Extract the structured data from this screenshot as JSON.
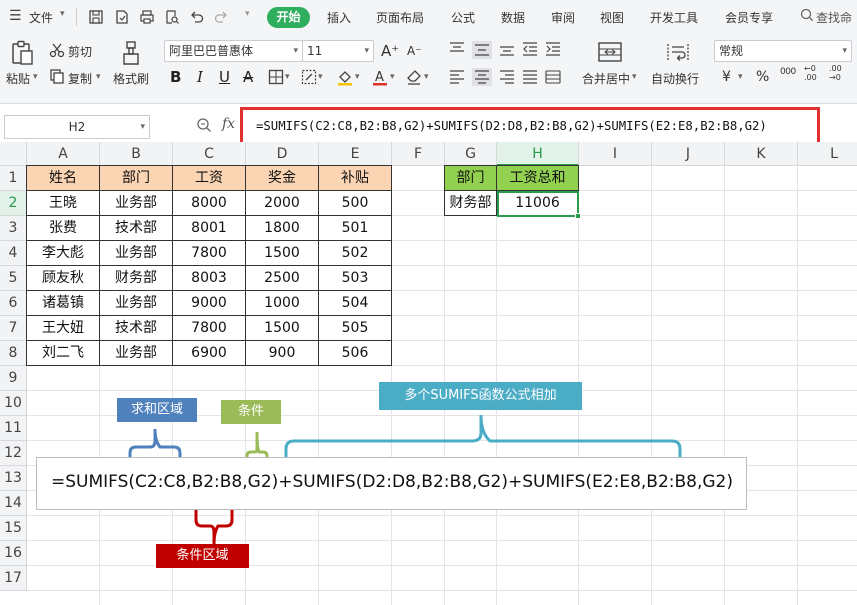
{
  "menubar": {
    "file_label": "文件",
    "tabs": [
      "开始",
      "插入",
      "页面布局",
      "公式",
      "数据",
      "审阅",
      "视图",
      "开发工具",
      "会员专享"
    ],
    "search_label": "查找命"
  },
  "ribbon": {
    "paste_label": "粘贴",
    "cut_label": "剪切",
    "copy_label": "复制",
    "format_painter_label": "格式刷",
    "font_name": "阿里巴巴普惠体",
    "font_size": "11",
    "merge_label": "合并居中",
    "wrap_label": "自动换行",
    "number_format": "常规",
    "currency_symbol": "¥",
    "percent_symbol": "%",
    "thousands_symbol": "000"
  },
  "formula_bar": {
    "name_box": "H2",
    "fx": "fx",
    "formula": "=SUMIFS(C2:C8,B2:B8,G2)+SUMIFS(D2:D8,B2:B8,G2)+SUMIFS(E2:E8,B2:B8,G2)"
  },
  "sheet": {
    "columns": [
      "A",
      "B",
      "C",
      "D",
      "E",
      "F",
      "G",
      "H",
      "I",
      "J",
      "K",
      "L"
    ],
    "rows": [
      "1",
      "2",
      "3",
      "4",
      "5",
      "6",
      "7",
      "8",
      "9",
      "10",
      "11",
      "12",
      "13",
      "14",
      "15",
      "16",
      "17"
    ],
    "selected_column": "H",
    "selected_row": "2",
    "table_headers": [
      "姓名",
      "部门",
      "工资",
      "奖金",
      "补贴"
    ],
    "table_rows": [
      [
        "王晓",
        "业务部",
        "8000",
        "2000",
        "500"
      ],
      [
        "张费",
        "技术部",
        "8001",
        "1800",
        "501"
      ],
      [
        "李大彪",
        "业务部",
        "7800",
        "1500",
        "502"
      ],
      [
        "顾友秋",
        "财务部",
        "8003",
        "2500",
        "503"
      ],
      [
        "诸葛镇",
        "业务部",
        "9000",
        "1000",
        "504"
      ],
      [
        "王大妞",
        "技术部",
        "7800",
        "1500",
        "505"
      ],
      [
        "刘二飞",
        "业务部",
        "6900",
        "900",
        "506"
      ]
    ],
    "lookup_headers": [
      "部门",
      "工资总和"
    ],
    "lookup_values": [
      "财务部",
      "11006"
    ]
  },
  "annotation": {
    "formula": "=SUMIFS(C2:C8,B2:B8,G2)+SUMIFS(D2:D8,B2:B8,G2)+SUMIFS(E2:E8,B2:B8,G2)",
    "sum_range_label": "求和区域",
    "criteria_label": "条件",
    "criteria_range_label": "条件区域",
    "multi_label": "多个SUMIFS函数公式相加",
    "colors": {
      "sum_range": "#4f81bd",
      "criteria": "#9bbb59",
      "criteria_range": "#c00000",
      "multi": "#4bacc6"
    }
  },
  "colors": {
    "accent": "#2fae5d",
    "formula_highlight": "#e0312e",
    "header_fill": "#fbd4b4",
    "lookup_header_fill": "#92d050"
  }
}
